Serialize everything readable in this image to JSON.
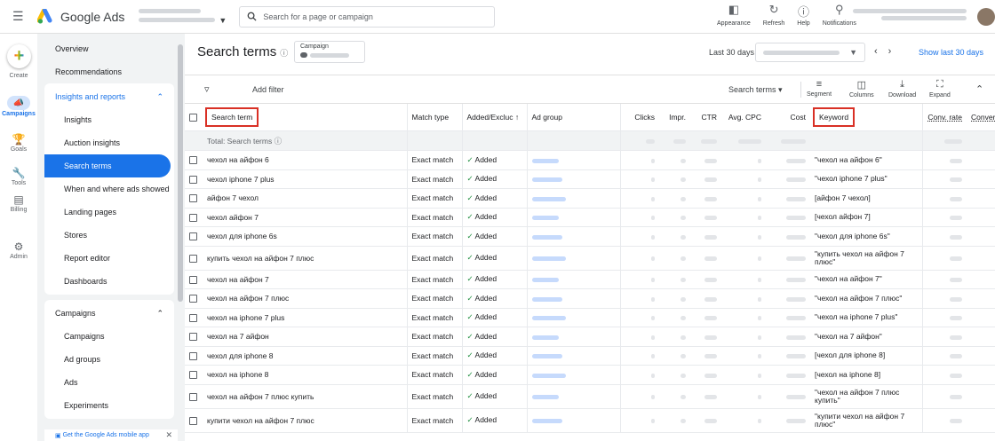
{
  "app": {
    "title": "Google Ads",
    "search_placeholder": "Search for a page or campaign"
  },
  "top_actions": [
    {
      "label": "Appearance",
      "icon": "appearance-icon"
    },
    {
      "label": "Refresh",
      "icon": "refresh-icon"
    },
    {
      "label": "Help",
      "icon": "help-icon"
    },
    {
      "label": "Notifications",
      "icon": "bell-icon"
    }
  ],
  "rail": {
    "create": "Create",
    "items": [
      {
        "label": "Campaigns",
        "icon": "campaigns-icon",
        "active": true
      },
      {
        "label": "Goals",
        "icon": "goals-icon"
      },
      {
        "label": "Tools",
        "icon": "tools-icon"
      },
      {
        "label": "Billing",
        "icon": "billing-icon"
      },
      {
        "label": "Admin",
        "icon": "admin-icon"
      }
    ]
  },
  "nav": {
    "overview": "Overview",
    "recommendations": "Recommendations",
    "insights_section": "Insights and reports",
    "insights_items": [
      "Insights",
      "Auction insights",
      "Search terms",
      "When and where ads showed",
      "Landing pages",
      "Stores",
      "Report editor",
      "Dashboards"
    ],
    "selected_item": "Search terms",
    "campaigns_section": "Campaigns",
    "campaigns_items": [
      "Campaigns",
      "Ad groups",
      "Ads",
      "Experiments"
    ],
    "promo": "Get the Google Ads mobile app"
  },
  "main": {
    "title": "Search terms",
    "campaign_label": "Campaign",
    "date_label": "Last 30 days",
    "show_last": "Show last 30 days",
    "add_filter": "Add filter",
    "view_select": "Search terms",
    "toolbar_buttons": [
      "Segment",
      "Columns",
      "Download",
      "Expand"
    ]
  },
  "table": {
    "headers": {
      "search_term": "Search term",
      "match_type": "Match type",
      "added": "Added/Excluc",
      "ad_group": "Ad group",
      "clicks": "Clicks",
      "impr": "Impr.",
      "ctr": "CTR",
      "avg_cpc": "Avg. CPC",
      "cost": "Cost",
      "keyword": "Keyword",
      "conv_rate": "Conv. rate",
      "conversions": "Conver"
    },
    "total_label": "Total: Search terms",
    "rows": [
      {
        "term": "чехол на айфон 6",
        "match": "Exact match",
        "status": "Added",
        "keyword": "\"чехол на айфон 6\""
      },
      {
        "term": "чехол iphone 7 plus",
        "match": "Exact match",
        "status": "Added",
        "keyword": "\"чехол iphone 7 plus\""
      },
      {
        "term": "айфон 7 чехол",
        "match": "Exact match",
        "status": "Added",
        "keyword": "[айфон 7 чехол]"
      },
      {
        "term": "чехол айфон 7",
        "match": "Exact match",
        "status": "Added",
        "keyword": "[чехол айфон 7]"
      },
      {
        "term": "чехол для iphone 6s",
        "match": "Exact match",
        "status": "Added",
        "keyword": "\"чехол для iphone 6s\""
      },
      {
        "term": "купить чехол на айфон 7 плюс",
        "match": "Exact match",
        "status": "Added",
        "keyword": "\"купить чехол на айфон 7 плюс\""
      },
      {
        "term": "чехол на айфон 7",
        "match": "Exact match",
        "status": "Added",
        "keyword": "\"чехол на айфон 7\""
      },
      {
        "term": "чехол на айфон 7 плюс",
        "match": "Exact match",
        "status": "Added",
        "keyword": "\"чехол на айфон 7 плюс\""
      },
      {
        "term": "чехол на iphone 7 plus",
        "match": "Exact match",
        "status": "Added",
        "keyword": "\"чехол на iphone 7 plus\""
      },
      {
        "term": "чехол на 7 айфон",
        "match": "Exact match",
        "status": "Added",
        "keyword": "\"чехол на 7 айфон\""
      },
      {
        "term": "чехол для iphone 8",
        "match": "Exact match",
        "status": "Added",
        "keyword": "[чехол для iphone 8]"
      },
      {
        "term": "чехол на iphone 8",
        "match": "Exact match",
        "status": "Added",
        "keyword": "[чехол на iphone 8]"
      },
      {
        "term": "чехол на айфон 7 плюс купить",
        "match": "Exact match",
        "status": "Added",
        "keyword": "\"чехол на айфон 7 плюс купить\""
      },
      {
        "term": "купити чехол на айфон 7 плюс",
        "match": "Exact match",
        "status": "Added",
        "keyword": "\"купити чехол на айфон 7 плюс\""
      }
    ]
  },
  "colors": {
    "accent": "#1a73e8",
    "highlight_box": "#d93025",
    "added_check": "#1e8e3e"
  }
}
